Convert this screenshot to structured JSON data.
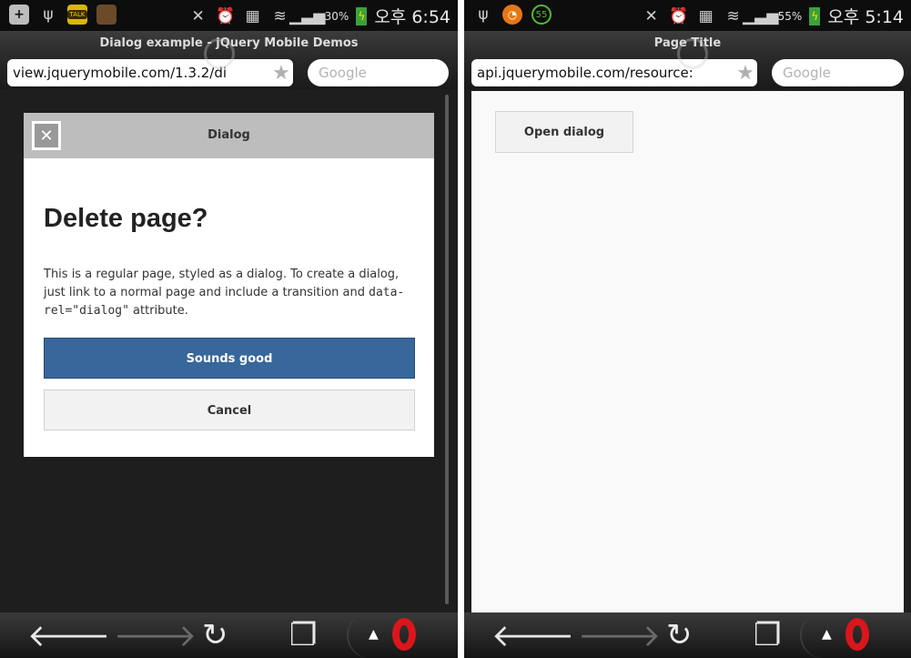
{
  "left_phone": {
    "status": {
      "icons": [
        "plus-icon",
        "usb-icon",
        "kakaotalk-icon",
        "game-icon",
        "mute-icon",
        "alarm-icon",
        "storage-icon",
        "wifi-icon",
        "signal-icon"
      ],
      "kakao_text": "TALK",
      "battery": "30%",
      "time": "오후 6:54"
    },
    "browser": {
      "title": "Dialog example - jQuery Mobile Demos",
      "url": "view.jquerymobile.com/1.3.2/di",
      "search_placeholder": "Google"
    },
    "dialog": {
      "header_title": "Dialog",
      "close_symbol": "✕",
      "heading": "Delete page?",
      "body_part1": "This is a regular page, styled as a dialog. To create a dialog, just link to a normal page and include a transition and ",
      "body_code": "data-rel=\"dialog\"",
      "body_part2": " attribute.",
      "primary_button": "Sounds good",
      "secondary_button": "Cancel"
    }
  },
  "right_phone": {
    "status": {
      "icons": [
        "usb-icon",
        "orange-app-icon",
        "badge-55-icon",
        "mute-icon",
        "alarm-icon",
        "storage-icon",
        "wifi-icon",
        "signal-icon"
      ],
      "badge_text": "55",
      "battery": "55%",
      "time": "오후 5:14"
    },
    "browser": {
      "title": "Page Title",
      "url": "api.jquerymobile.com/resource:",
      "search_placeholder": "Google"
    },
    "content": {
      "open_button": "Open dialog"
    }
  },
  "navbar": {
    "back_icon": "back-arrow-icon",
    "forward_icon": "forward-arrow-icon",
    "reload_icon": "reload-icon",
    "tabs_icon": "tabs-icon",
    "opera_icon": "opera-menu-icon"
  }
}
